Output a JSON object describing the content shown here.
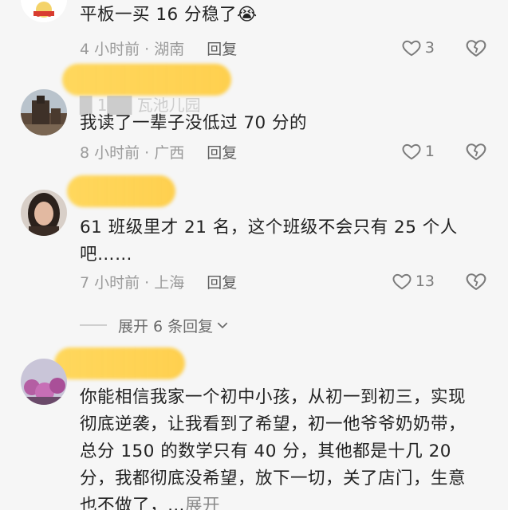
{
  "comments": [
    {
      "text": "平板一买 16 分稳了😭",
      "time": "4 小时前 · 湖南",
      "reply_label": "回复",
      "likes": "3",
      "avatar": "mascot-avatar"
    },
    {
      "username": "█ 1██ 瓦池儿园",
      "text": "我读了一辈子没低过 70 分的",
      "time": "8 小时前 · 广西",
      "reply_label": "回复",
      "likes": "1",
      "avatar": "castle-avatar"
    },
    {
      "text": "61 班级里才 21 名，这个班级不会只有 25 个人吧……",
      "time": "7 小时前 · 上海",
      "reply_label": "回复",
      "likes": "13",
      "avatar": "woman-avatar"
    },
    {
      "text": "你能相信我家一个初中小孩，从初一到初三，实现彻底逆袭，让我看到了希望，初一他爷爷奶奶带，总分 150 的数学只有 40 分，其他都是十几 20 分，我都彻底没希望，放下一切，关了店门，生意也不做了，…",
      "more_label": "展开",
      "avatar": "flowers-avatar"
    }
  ],
  "expand_replies": {
    "label": "展开 6 条回复"
  },
  "colors": {
    "highlight": "#ffd454",
    "meta": "#9a9a9a",
    "background": "#f6f6f6"
  }
}
